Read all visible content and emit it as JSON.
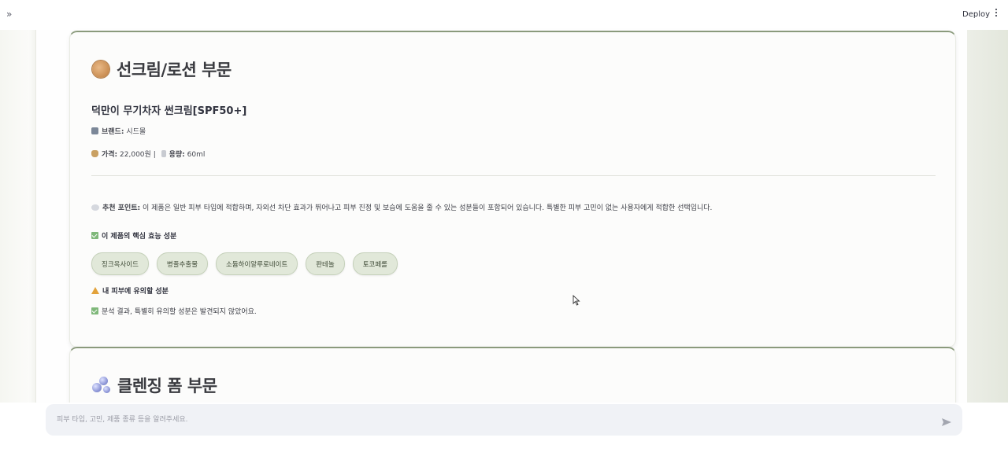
{
  "header": {
    "expand_label": "»",
    "deploy_label": "Deploy"
  },
  "card1": {
    "section_title": "선크림/로션 부문",
    "product_name": "덕만이 무기차자 썬크림[SPF50+]",
    "brand_label": "브랜드:",
    "brand_value": "시드몰",
    "price_label": "가격:",
    "price_value": "22,000원",
    "separator": "|",
    "volume_label": "용량:",
    "volume_value": "60ml",
    "recommend_label": "추천 포인트:",
    "recommend_text": "이 제품은 일반 피부 타입에 적합하며, 자외선 차단 효과가 뛰어나고 피부 진정 및 보습에 도움을 줄 수 있는 성분들이 포함되어 있습니다. 특별한 피부 고민이 없는 사용자에게 적합한 선택입니다.",
    "key_ingredients_heading": "이 제품의 핵심 효능 성분",
    "key_ingredients": [
      "징크옥사이드",
      "병풀추출물",
      "소듐하이알루로네이트",
      "판테놀",
      "토코페롤"
    ],
    "caution_heading": "내 피부에 유의할 성분",
    "caution_result": "분석 결과, 특별히 유의할 성분은 발견되지 않았어요."
  },
  "card2": {
    "section_title": "클렌징 폼 부문"
  },
  "chat": {
    "placeholder": "피부 타입, 고민, 제품 종류 등을 알려주세요."
  },
  "icons": {
    "sunscreen": "cookie-icon",
    "cleansing": "bubbles-icon",
    "brand": "building-icon",
    "price": "money-bag-icon",
    "volume": "bottle-icon",
    "recommend": "speech-bubble-icon",
    "key": "check-box-icon",
    "caution": "warning-icon",
    "result": "check-box-icon",
    "send": "send-icon"
  },
  "colors": {
    "accent": "#8a9a7c",
    "tag_bg": "#e1e8d9",
    "tag_border": "#c5d1ba"
  }
}
